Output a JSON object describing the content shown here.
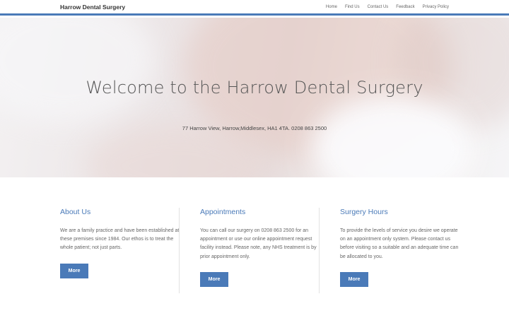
{
  "navbar": {
    "brand": "Harrow Dental Surgery",
    "links": [
      "Home",
      "Find Us",
      "Contact Us",
      "Feedback",
      "Privacy Policy"
    ]
  },
  "hero": {
    "title": "Welcome to the Harrow Dental Surgery",
    "subtitle": "77 Harrow View, Harrow,Middlesex, HA1 4TA. 0208 863 2500"
  },
  "sections": [
    {
      "heading": "About Us",
      "text": "We are a family practice and have been established at these premises since 1984. Our ethos is to treat the whole patient; not just parts.",
      "button": "More"
    },
    {
      "heading": "Appointments",
      "text": "You can call our surgery on 0208 863 2500 for an appointment or use our online appointment request facility instead. Please note, any NHS treatment is by prior appointment only.",
      "button": "More"
    },
    {
      "heading": "Surgery Hours",
      "text": "To provide the levels of service you desire we operate on an appointment only system. Please contact us before visiting so a suitable and an adequate time can be allocated to you.",
      "button": "More"
    }
  ],
  "colors": {
    "accent": "#4a7ab8"
  }
}
